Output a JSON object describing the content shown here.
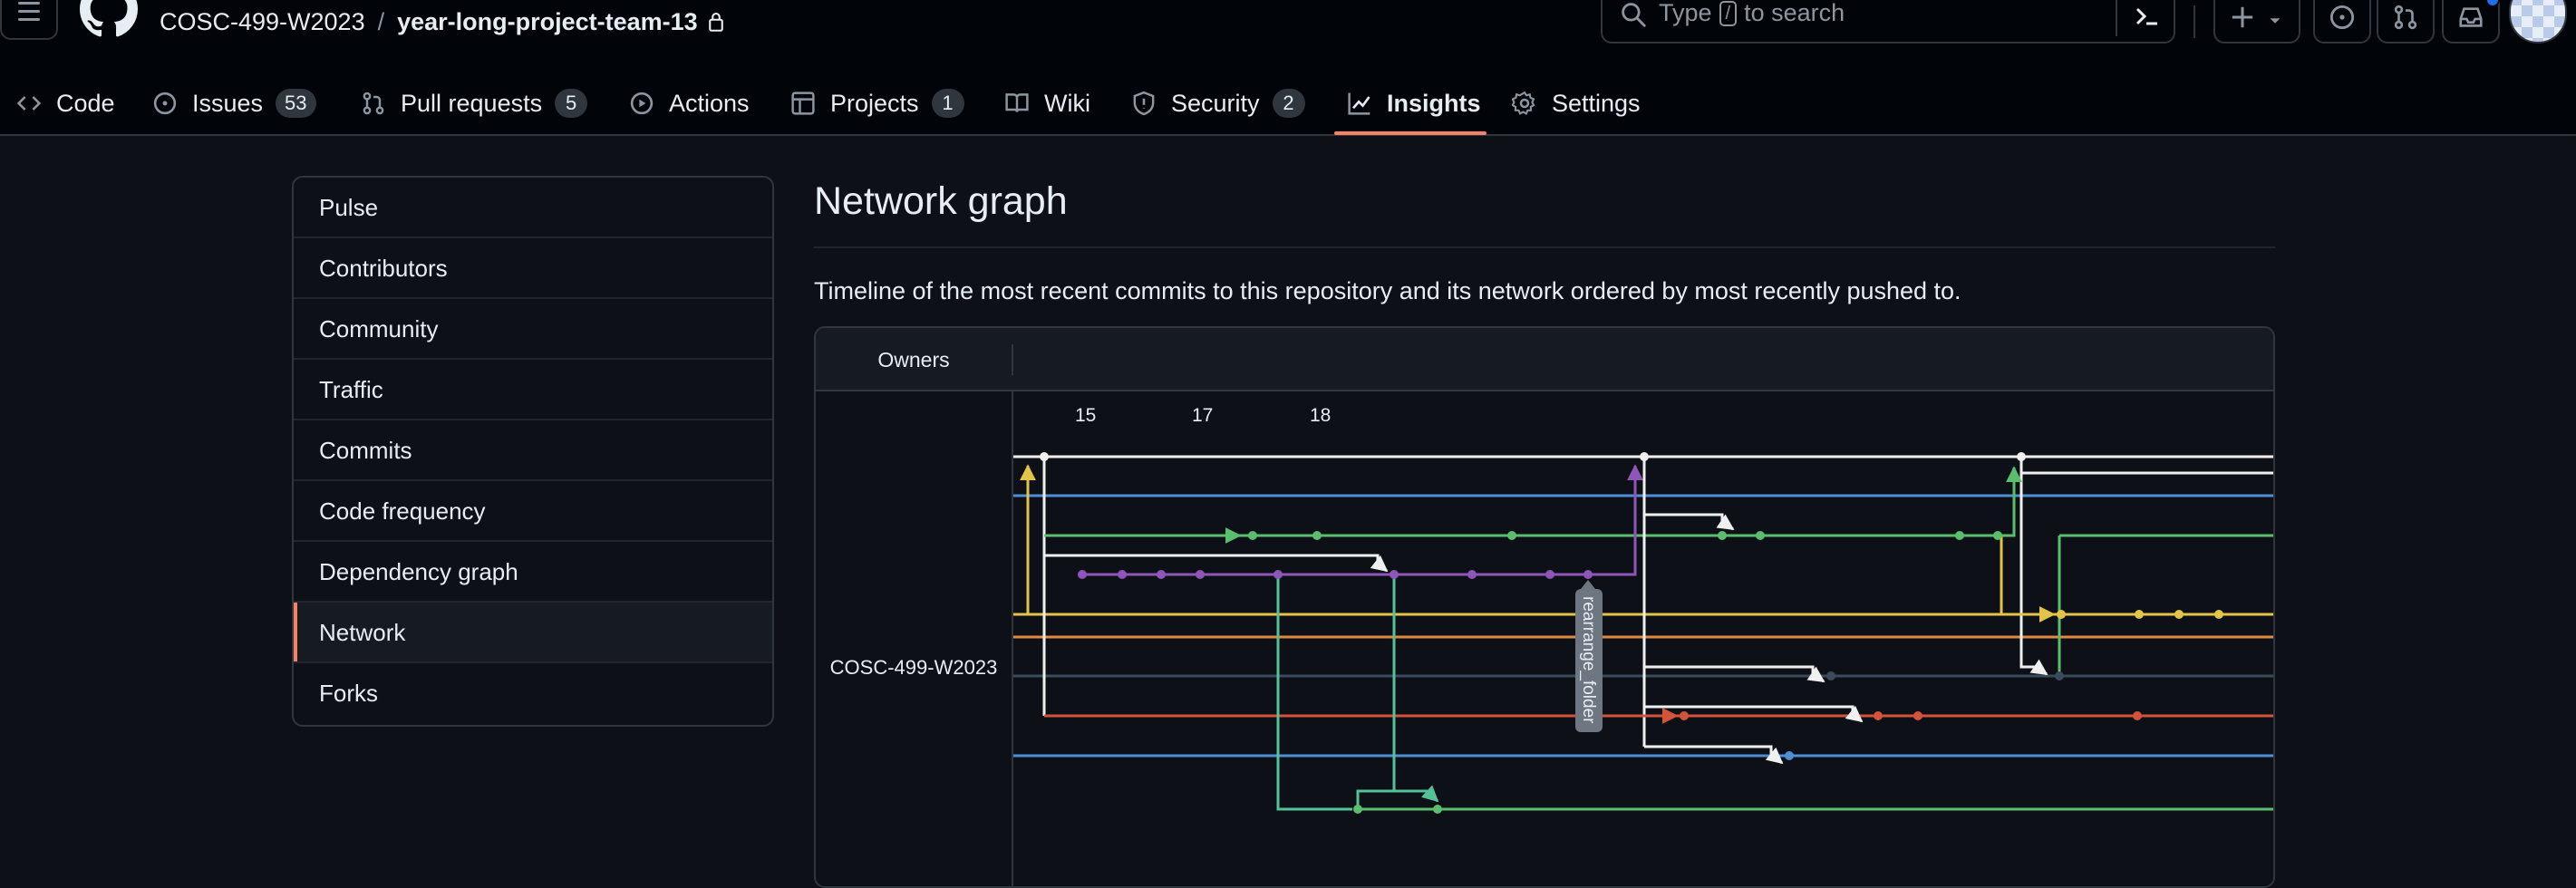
{
  "header": {
    "owner": "COSC-499-W2023",
    "separator": "/",
    "repo": "year-long-project-team-13",
    "search_placeholder_prefix": "Type",
    "search_key": "/",
    "search_placeholder_suffix": "to search"
  },
  "nav": {
    "code": "Code",
    "issues": "Issues",
    "issues_count": "53",
    "pulls": "Pull requests",
    "pulls_count": "5",
    "actions": "Actions",
    "projects": "Projects",
    "projects_count": "1",
    "wiki": "Wiki",
    "security": "Security",
    "security_count": "2",
    "insights": "Insights",
    "settings": "Settings",
    "selected": "Insights"
  },
  "sidebar": {
    "items": [
      {
        "label": "Pulse"
      },
      {
        "label": "Contributors"
      },
      {
        "label": "Community"
      },
      {
        "label": "Traffic"
      },
      {
        "label": "Commits"
      },
      {
        "label": "Code frequency"
      },
      {
        "label": "Dependency graph"
      },
      {
        "label": "Network"
      },
      {
        "label": "Forks"
      }
    ],
    "active": "Network"
  },
  "main": {
    "title": "Network graph",
    "description": "Timeline of the most recent commits to this repository and its network ordered by most recently pushed to."
  },
  "graph": {
    "owners_header": "Owners",
    "owner": "COSC-499-W2023",
    "dates": [
      "15",
      "17",
      "18"
    ],
    "tooltip": "rearrange_folder",
    "colors": {
      "white": "#f0f0f0",
      "blue": "#4f8fd6",
      "green": "#5bbd6e",
      "purple": "#8f55b8",
      "yellow": "#e3c44b",
      "orange": "#e18a3f",
      "navy": "#3b4a5c",
      "red": "#d4533b",
      "teal": "#55c199"
    }
  }
}
